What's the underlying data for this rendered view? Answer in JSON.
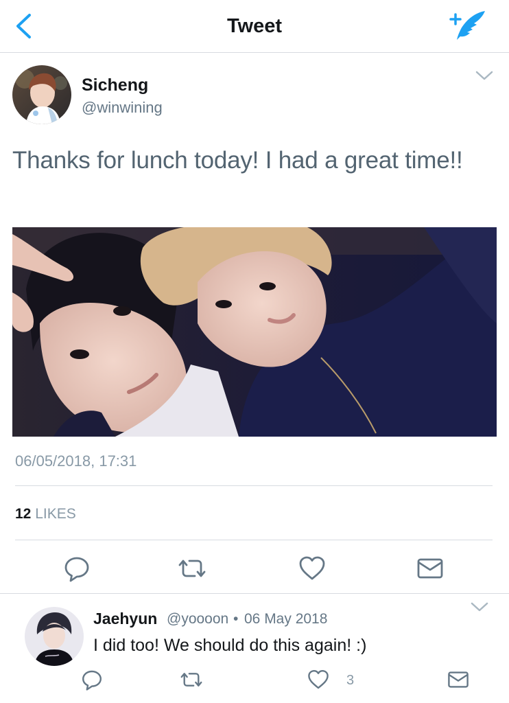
{
  "nav": {
    "title": "Tweet",
    "back_icon": "chevron-left-icon",
    "compose_icon": "compose-tweet-icon",
    "accent_color": "#1da1f2"
  },
  "tweet": {
    "author": {
      "name": "Sicheng",
      "handle": "@winwining"
    },
    "text": "Thanks for lunch today! I had a great time!!",
    "timestamp": "06/05/2018, 17:31",
    "likes_count": "12",
    "likes_label": "LIKES",
    "actions": [
      "reply-icon",
      "retweet-icon",
      "like-icon",
      "direct-message-icon"
    ]
  },
  "reply": {
    "name": "Jaehyun",
    "handle": "@yoooon",
    "separator": "•",
    "date": "06 May 2018",
    "text": "I did too! We should do this again! :)",
    "like_count": "3",
    "actions": [
      "reply-icon",
      "retweet-icon",
      "like-icon",
      "direct-message-icon"
    ]
  }
}
